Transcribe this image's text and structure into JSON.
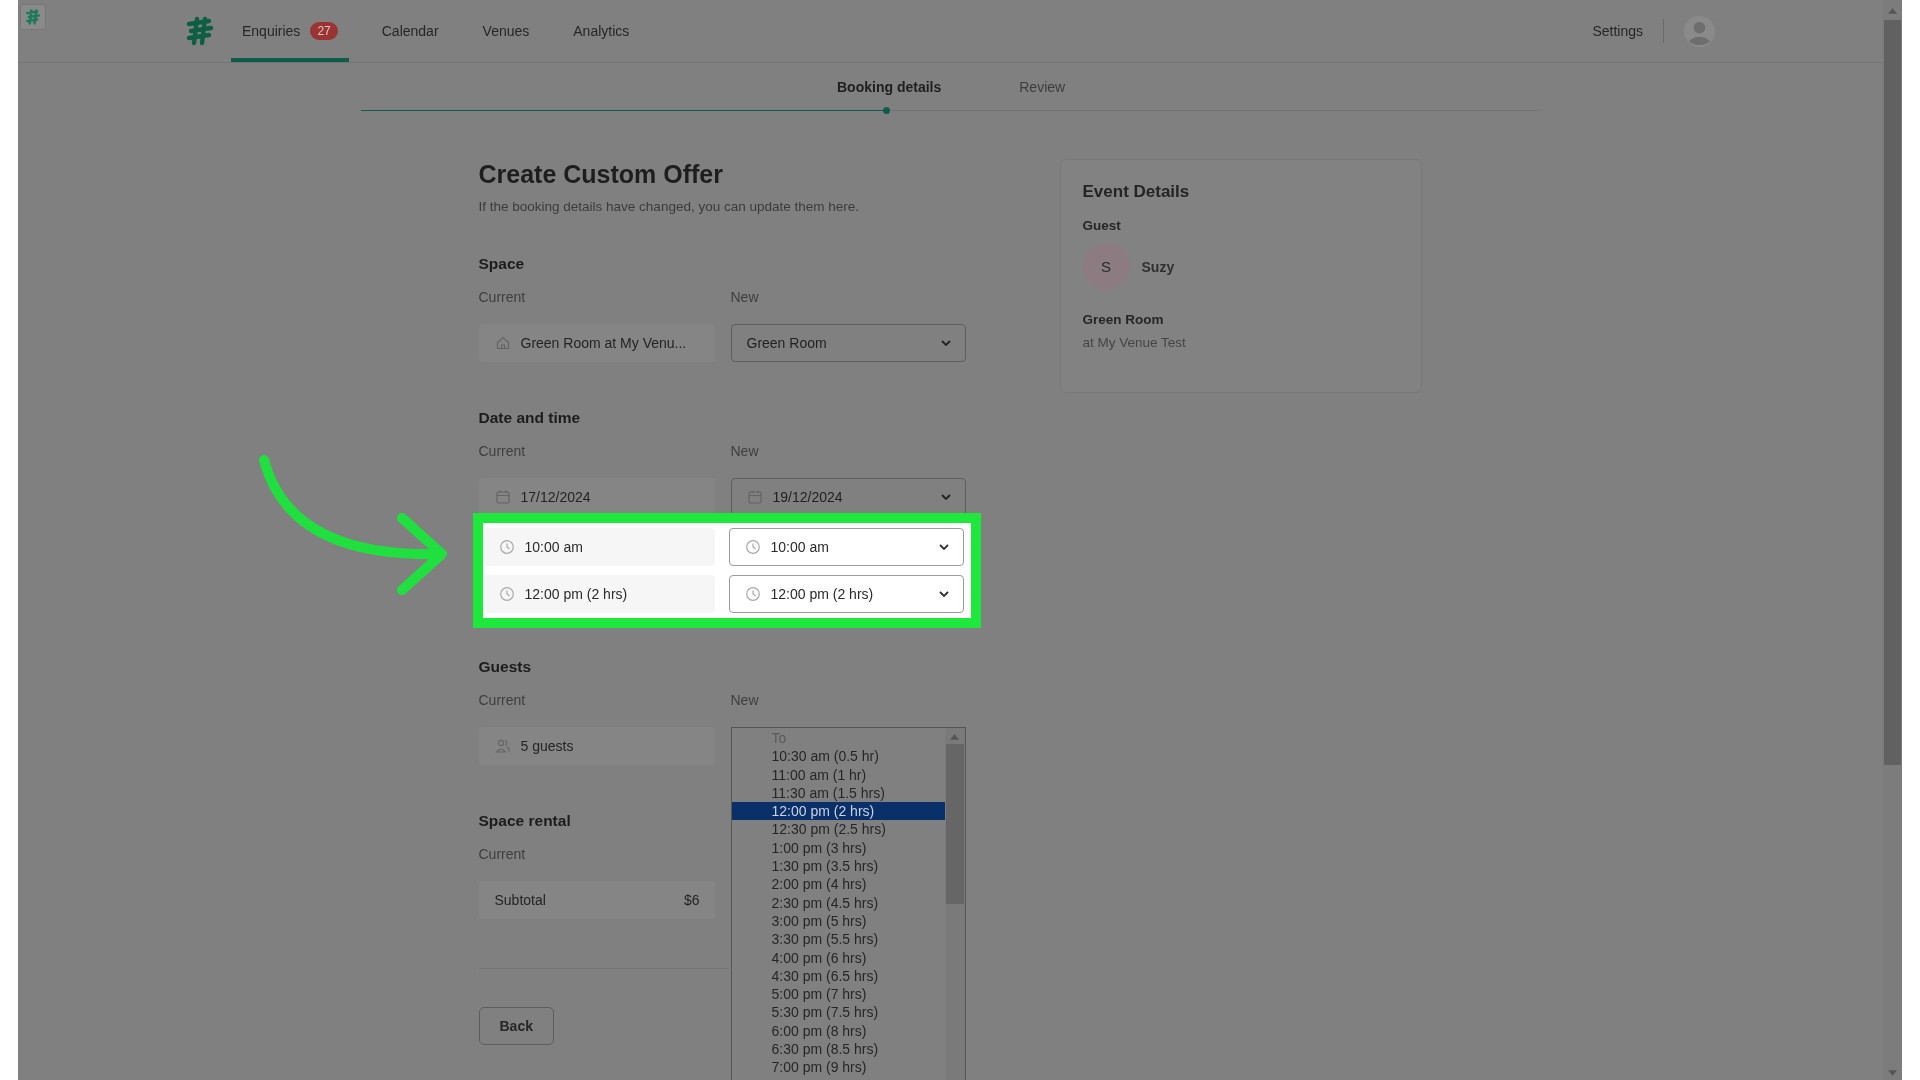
{
  "nav": {
    "tabs": [
      {
        "label": "Enquiries",
        "badge": "27",
        "selected": true
      },
      {
        "label": "Calendar",
        "selected": false
      },
      {
        "label": "Venues",
        "selected": false
      },
      {
        "label": "Analytics",
        "selected": false
      }
    ],
    "settings": "Settings"
  },
  "stepper": {
    "steps": [
      {
        "label": "Booking details",
        "selected": true
      },
      {
        "label": "Review",
        "selected": false
      }
    ]
  },
  "form": {
    "title": "Create Custom Offer",
    "subtitle": "If the booking details have changed, you can update them here.",
    "sections": [
      {
        "heading": "Space",
        "current_label": "Current",
        "new_label": "New",
        "rows": [
          {
            "kind": "space",
            "highlighted": false,
            "current": "Green Room at My Venu...",
            "new": "Green Room"
          }
        ]
      },
      {
        "heading": "Date and time",
        "current_label": "Current",
        "new_label": "New",
        "rows": [
          {
            "kind": "date",
            "highlighted": false,
            "current": "17/12/2024",
            "new": "19/12/2024"
          },
          {
            "kind": "start_time",
            "highlighted": true,
            "current": "10:00 am",
            "new": "10:00 am"
          },
          {
            "kind": "end_time",
            "highlighted": true,
            "current": "12:00 pm (2 hrs)",
            "new": "12:00 pm (2 hrs)"
          }
        ]
      },
      {
        "heading": "Guests",
        "current_label": "Current",
        "new_label": "New",
        "rows": [
          {
            "kind": "guests",
            "highlighted": false,
            "current": "5 guests",
            "listbox": {
              "header": "To",
              "options": [
                {
                  "label": "10:30 am (0.5 hr)",
                  "selected": false
                },
                {
                  "label": "11:00 am (1 hr)",
                  "selected": false
                },
                {
                  "label": "11:30 am (1.5 hrs)",
                  "selected": false
                },
                {
                  "label": "12:00 pm (2 hrs)",
                  "selected": true
                },
                {
                  "label": "12:30 pm (2.5 hrs)",
                  "selected": false
                },
                {
                  "label": "1:00 pm (3 hrs)",
                  "selected": false
                },
                {
                  "label": "1:30 pm (3.5 hrs)",
                  "selected": false
                },
                {
                  "label": "2:00 pm (4 hrs)",
                  "selected": false
                },
                {
                  "label": "2:30 pm (4.5 hrs)",
                  "selected": false
                },
                {
                  "label": "3:00 pm (5 hrs)",
                  "selected": false
                },
                {
                  "label": "3:30 pm (5.5 hrs)",
                  "selected": false
                },
                {
                  "label": "4:00 pm (6 hrs)",
                  "selected": false
                },
                {
                  "label": "4:30 pm (6.5 hrs)",
                  "selected": false
                },
                {
                  "label": "5:00 pm (7 hrs)",
                  "selected": false
                },
                {
                  "label": "5:30 pm (7.5 hrs)",
                  "selected": false
                },
                {
                  "label": "6:00 pm (8 hrs)",
                  "selected": false
                },
                {
                  "label": "6:30 pm (8.5 hrs)",
                  "selected": false
                },
                {
                  "label": "7:00 pm (9 hrs)",
                  "selected": false
                }
              ]
            }
          }
        ]
      },
      {
        "heading": "Space rental",
        "current_label": "Current",
        "rows": [
          {
            "kind": "subtotal",
            "highlighted": false,
            "label": "Subtotal",
            "amount": "$6"
          }
        ]
      }
    ],
    "back_button": "Back"
  },
  "event_details": {
    "title": "Event Details",
    "guest_label": "Guest",
    "guest": {
      "initial": "S",
      "name": "Suzy"
    },
    "space": "Green Room",
    "venue": "at My Venue Test"
  }
}
